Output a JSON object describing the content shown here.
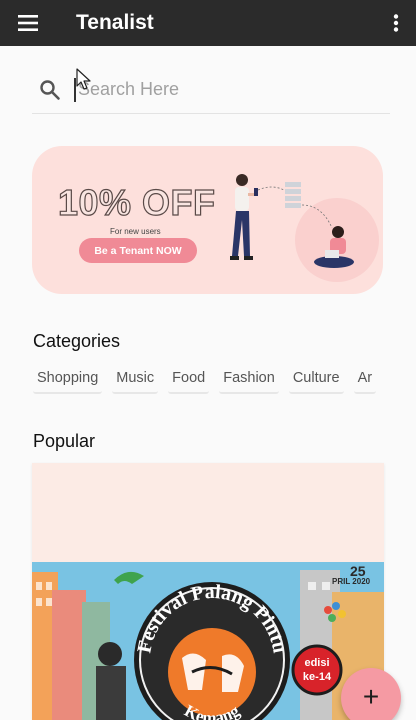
{
  "appbar": {
    "title": "Tenalist",
    "menu_icon": "hamburger-menu-icon",
    "more_icon": "more-vertical-icon",
    "background": "#2b2b2b"
  },
  "search": {
    "placeholder": "Search Here",
    "icon": "search-icon"
  },
  "banner": {
    "offer": "10% OFF",
    "subtitle": "For new users",
    "cta": "Be a Tenant NOW",
    "background": "#fde0dc",
    "cta_color": "#f08a96"
  },
  "categories": {
    "title": "Categories",
    "items": [
      "Shopping",
      "Music",
      "Food",
      "Fashion",
      "Culture",
      "Ar"
    ]
  },
  "popular": {
    "title": "Popular",
    "poster": {
      "arc_text": "Festival Palang Pintu",
      "bottom_text": "Kemang",
      "badge_line1": "edisi",
      "badge_line2": "ke-14",
      "date_fragment": "PRIL 2020",
      "date_day": "25"
    }
  },
  "fab": {
    "label": "+",
    "color": "#f59aa3"
  }
}
